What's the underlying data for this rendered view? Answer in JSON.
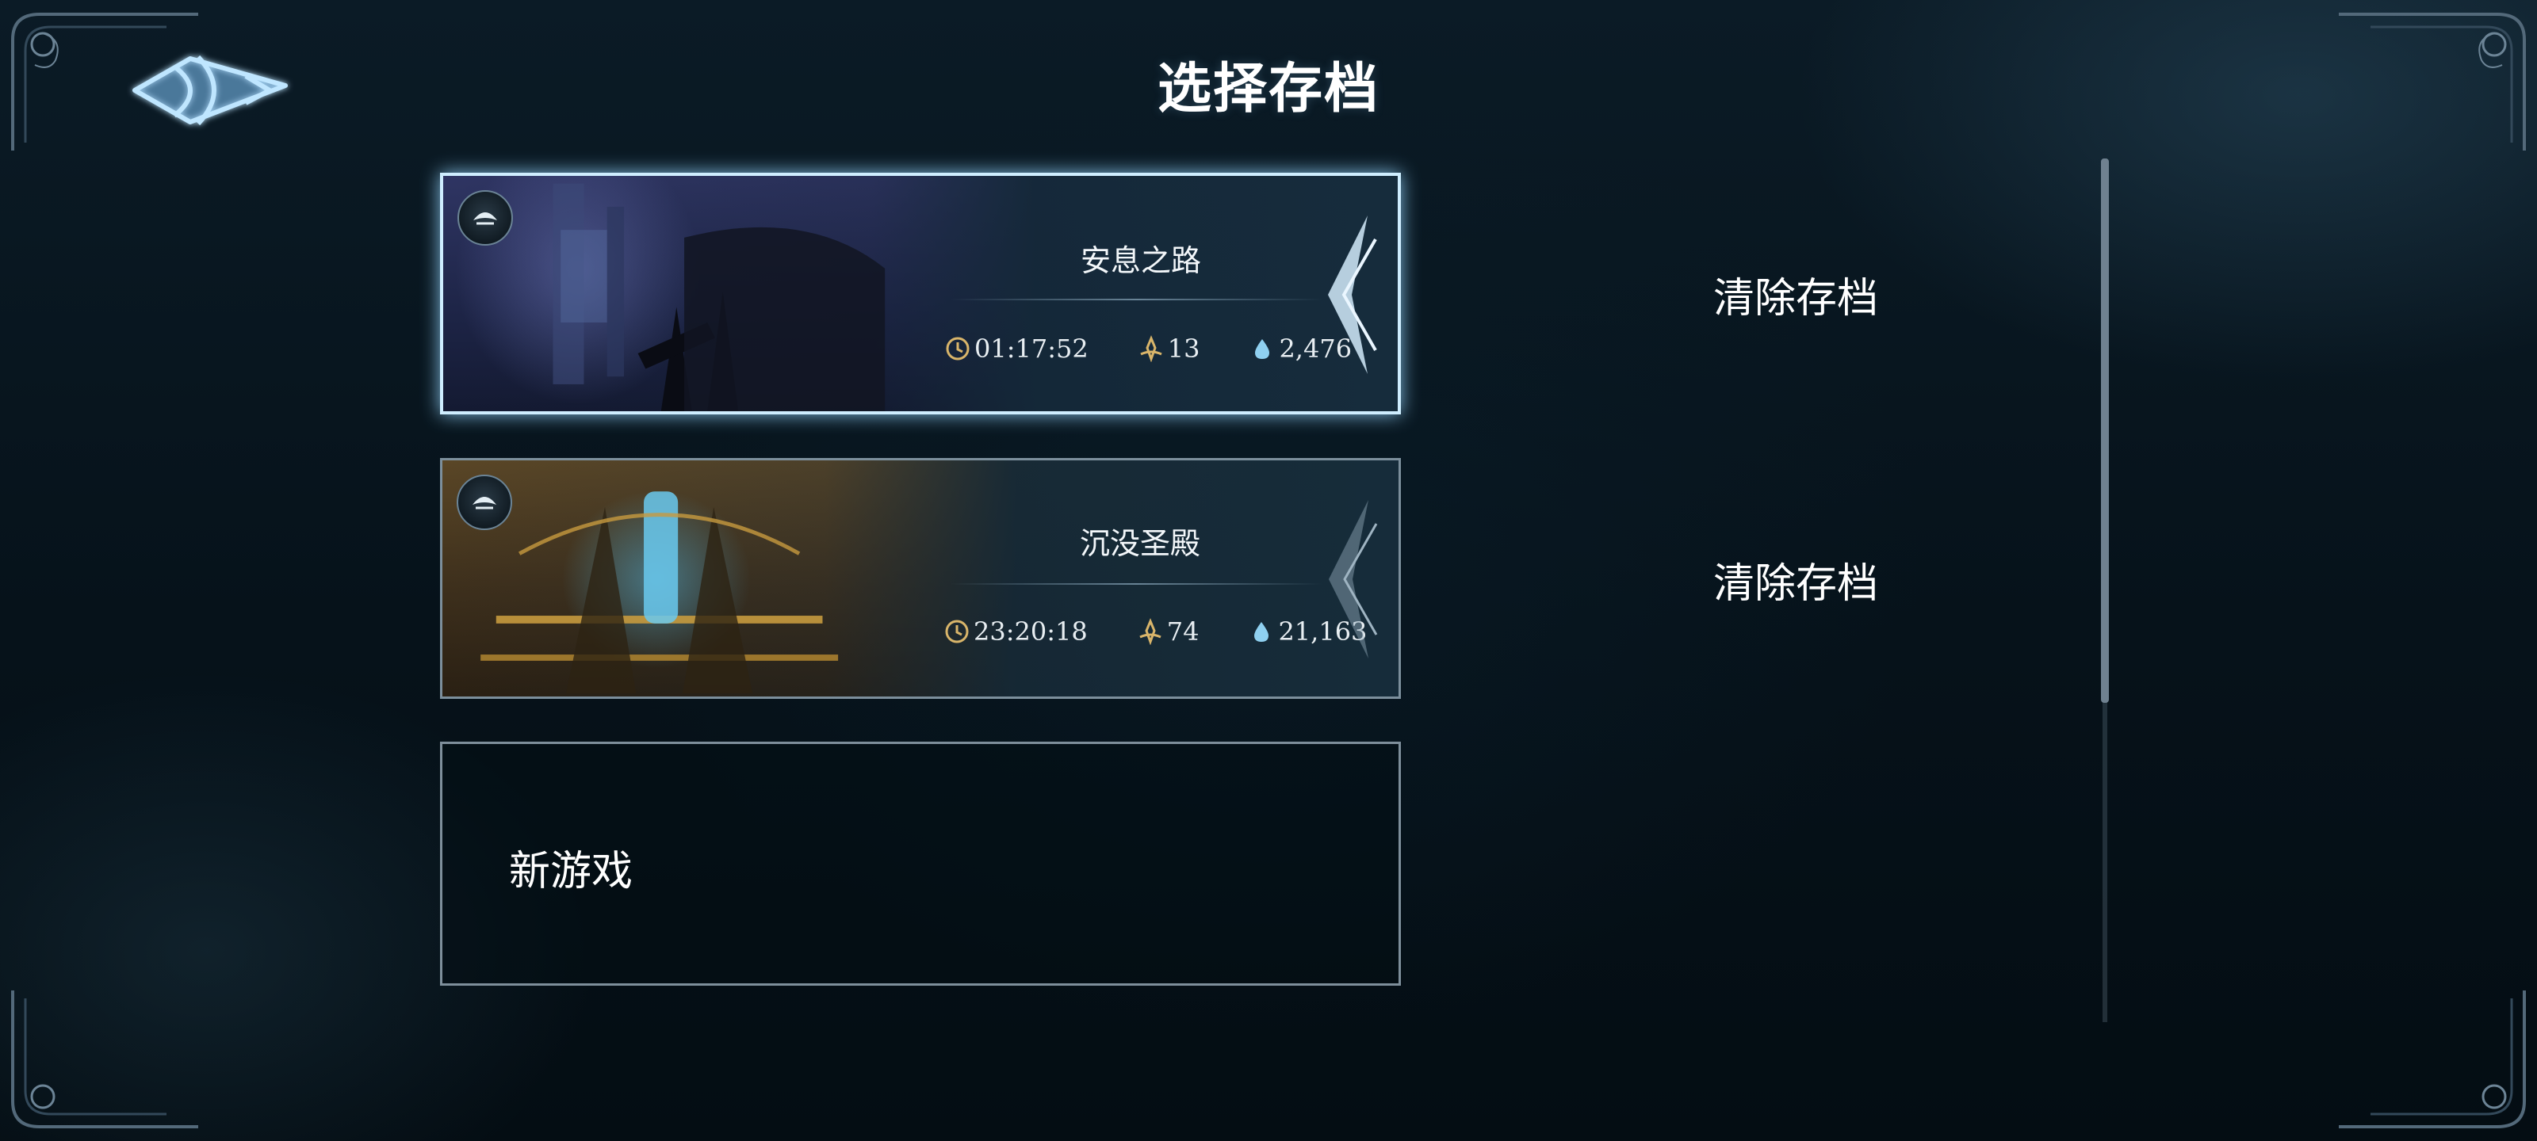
{
  "header": {
    "title": "选择存档",
    "back_icon": "winged-arrow-back-icon"
  },
  "slots": [
    {
      "name": "安息之路",
      "playtime": "01:17:52",
      "level": "13",
      "currency": "2,476",
      "selected": true,
      "clear_label": "清除存档"
    },
    {
      "name": "沉没圣殿",
      "playtime": "23:20:18",
      "level": "74",
      "currency": "21,163",
      "selected": false,
      "clear_label": "清除存档"
    }
  ],
  "new_game": {
    "label": "新游戏"
  },
  "icons": {
    "playtime": "clock-icon",
    "level": "level-sigil-icon",
    "currency": "droplet-icon",
    "slot_badge": "emblem-badge-icon"
  },
  "colors": {
    "accent_glow": "#cfeeff",
    "stat_icon_gold": "#d9b56a",
    "droplet_blue": "#8fd0f0"
  },
  "scrollbar": {
    "visible_fraction": 0.63,
    "position": 0.0
  }
}
